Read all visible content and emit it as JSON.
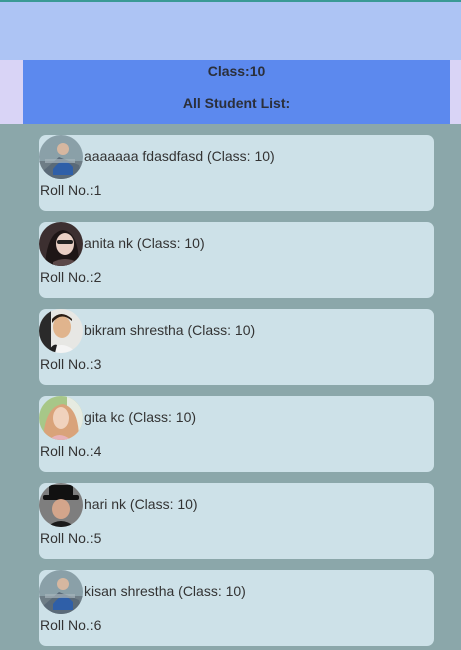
{
  "header": {
    "class_title": "Class:10",
    "list_title": "All Student List:"
  },
  "students": [
    {
      "name_line": "aaaaaaa fdasdfasd (Class: 10)",
      "roll_line": "Roll No.:1",
      "avatar": "person-photo-avatar"
    },
    {
      "name_line": "anita nk (Class: 10)",
      "roll_line": "Roll No.:2",
      "avatar": "person-photo-avatar"
    },
    {
      "name_line": "bikram shrestha (Class: 10)",
      "roll_line": "Roll No.:3",
      "avatar": "person-photo-avatar"
    },
    {
      "name_line": "gita kc (Class: 10)",
      "roll_line": "Roll No.:4",
      "avatar": "person-photo-avatar"
    },
    {
      "name_line": "hari nk (Class: 10)",
      "roll_line": "Roll No.:5",
      "avatar": "person-photo-avatar"
    },
    {
      "name_line": "kisan shrestha (Class: 10)",
      "roll_line": "Roll No.:6",
      "avatar": "person-photo-avatar"
    }
  ],
  "colors": {
    "top_bar": "#adc4f4",
    "header": "#5c89ee",
    "background": "#8ba7aa",
    "card": "#cde1e8"
  }
}
